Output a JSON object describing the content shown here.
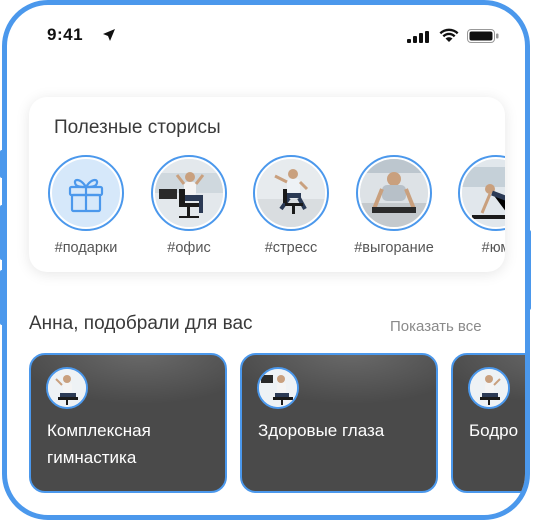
{
  "status_bar": {
    "time": "9:41"
  },
  "stories": {
    "title": "Полезные сторисы",
    "items": [
      {
        "label": "#подарки",
        "icon": "gift-icon"
      },
      {
        "label": "#офис"
      },
      {
        "label": "#стресс"
      },
      {
        "label": "#выгорание"
      },
      {
        "label": "#юм"
      }
    ]
  },
  "recommendations": {
    "title": "Анна, подобрали для вас",
    "show_all": "Показать все",
    "cards": [
      {
        "title": "Комплексная гимнастика"
      },
      {
        "title": "Здоровые глаза"
      },
      {
        "title": "Бодро"
      }
    ]
  },
  "colors": {
    "accent": "#4b98ec",
    "card_bg": "#4a4a4a"
  }
}
